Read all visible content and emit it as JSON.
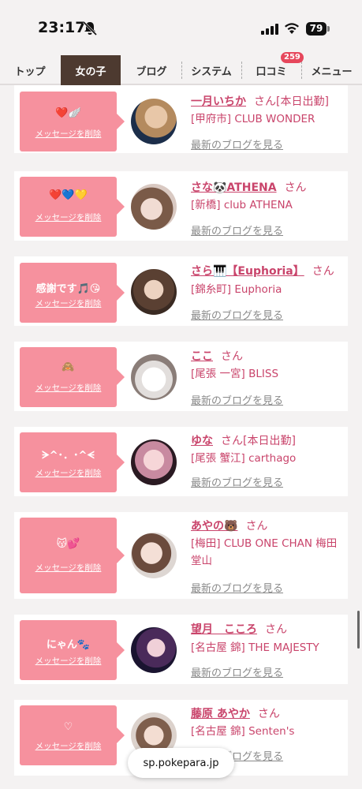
{
  "status_bar": {
    "time": "23:17",
    "battery": "79"
  },
  "nav": {
    "items": [
      "トップ",
      "女の子",
      "ブログ",
      "システム",
      "口コミ",
      "メニュー"
    ],
    "active_index": 1,
    "badge": "259"
  },
  "delete_label": "メッセージを削除",
  "blog_label": "最新のブログを見る",
  "san_label": "さん",
  "cards": [
    {
      "message": "❤️🪽",
      "name": "一月いちか",
      "status": "[本日出勤]",
      "shop": "[甲府市] CLUB WONDER"
    },
    {
      "message": "❤️💙💛",
      "name": "さな🐼ATHENA",
      "status": "",
      "shop": "[新橋] club ATHENA"
    },
    {
      "message": "感謝です🎵😘",
      "name": "さら🎹【Euphoria】",
      "status": "",
      "shop": "[錦糸町] Euphoria"
    },
    {
      "message": "🙈",
      "name": "ここ",
      "status": "",
      "shop": "[尾張 一宮] BLISS"
    },
    {
      "message": "ᗒ^･．･^ᗕ",
      "name": "ゆな",
      "status": "[本日出勤]",
      "shop": "[尾張 蟹江] carthago"
    },
    {
      "message": "😽💕",
      "name": "あやの🐻",
      "status": "",
      "shop": "[梅田] CLUB ONE CHAN 梅田堂山"
    },
    {
      "message": "にゃん🐾",
      "name": "望月　こころ",
      "status": "",
      "shop": "[名古屋 錦] THE MAJESTY"
    },
    {
      "message": "♡",
      "name": "藤原 あやか",
      "status": "",
      "shop": "[名古屋 錦] Senten's"
    }
  ],
  "url_pill": "sp.pokepara.jp",
  "colors": {
    "accent": "#c9446b",
    "bubble": "#f6919e",
    "nav_active": "#4d3a30"
  }
}
